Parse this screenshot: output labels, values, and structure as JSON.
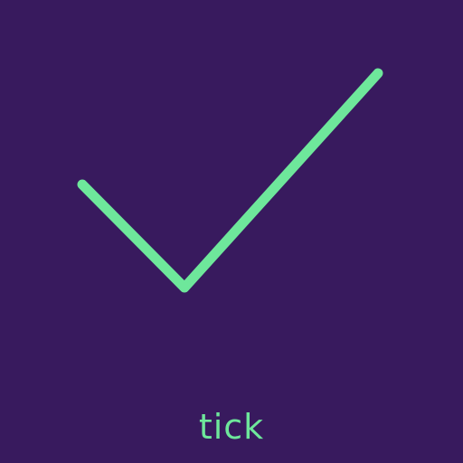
{
  "icon": {
    "name": "checkmark-icon",
    "color": "#6ee79b"
  },
  "caption": "tick",
  "background_color": "#381a5e"
}
